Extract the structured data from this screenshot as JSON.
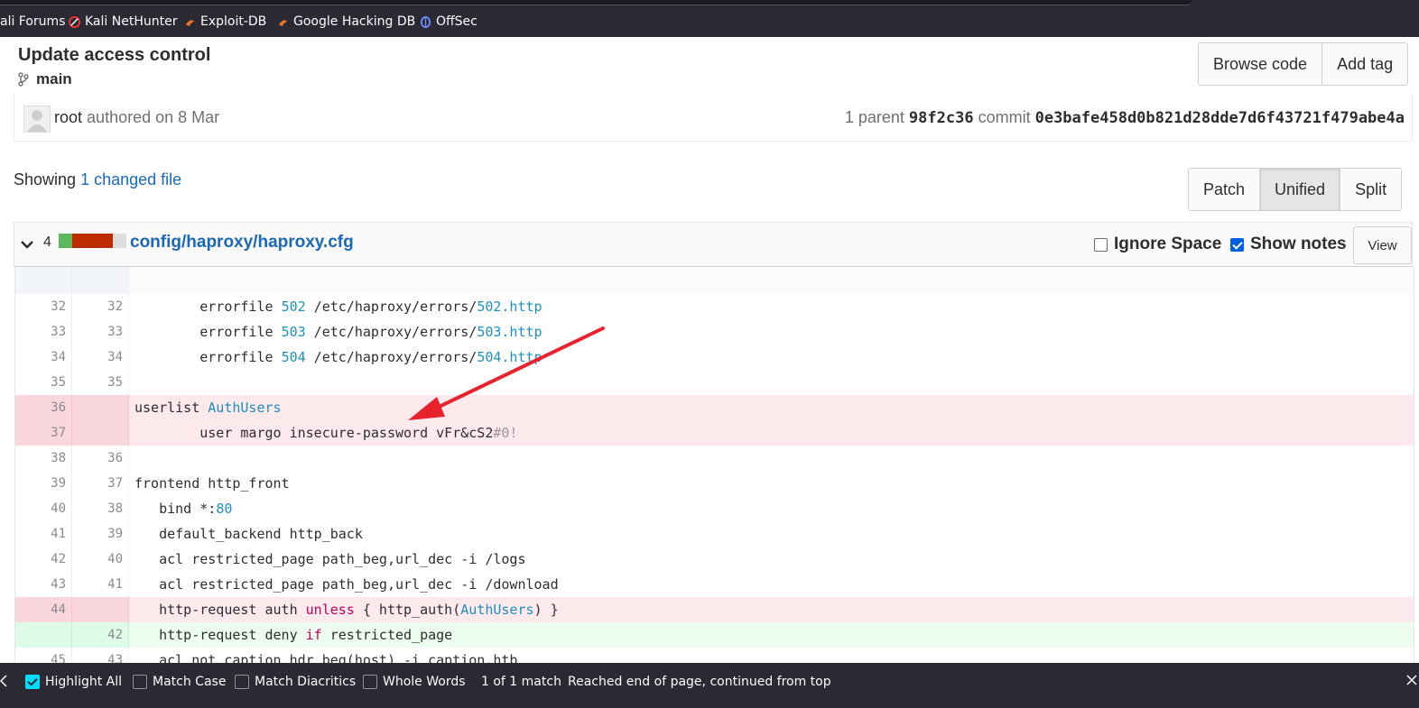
{
  "bookmarks": [
    {
      "label": "ali Forums",
      "icon": "forum-icon"
    },
    {
      "label": "Kali NetHunter",
      "icon": "nethunter-icon"
    },
    {
      "label": "Exploit-DB",
      "icon": "exploitdb-icon"
    },
    {
      "label": "Google Hacking DB",
      "icon": "ghdb-icon"
    },
    {
      "label": "OffSec",
      "icon": "offsec-icon"
    }
  ],
  "commit": {
    "title": "Update access control",
    "branch": "main",
    "browse_code": "Browse code",
    "add_tag": "Add tag",
    "author": "root",
    "authored_text": "authored on 8 Mar",
    "parent_label": "1 parent",
    "parent_sha": "98f2c36",
    "commit_label": "commit",
    "commit_sha": "0e3bafe458d0b821d28dde7d6f43721f479abe4a"
  },
  "changes": {
    "showing": "Showing",
    "changed_link": "1 changed file",
    "view_modes": [
      "Patch",
      "Unified",
      "Split"
    ],
    "active_mode": "Unified"
  },
  "file": {
    "change_count": "4",
    "path": "config/haproxy/haproxy.cfg",
    "ignore_space": "Ignore Space",
    "show_notes": "Show notes",
    "view": "View"
  },
  "diff_lines": [
    {
      "old": "32",
      "new": "32",
      "type": "ctx"
    },
    {
      "old": "33",
      "new": "33",
      "type": "ctx"
    },
    {
      "old": "34",
      "new": "34",
      "type": "ctx"
    },
    {
      "old": "35",
      "new": "35",
      "type": "ctx"
    },
    {
      "old": "36",
      "new": "",
      "type": "del"
    },
    {
      "old": "37",
      "new": "",
      "type": "del"
    },
    {
      "old": "38",
      "new": "36",
      "type": "ctx"
    },
    {
      "old": "39",
      "new": "37",
      "type": "ctx"
    },
    {
      "old": "40",
      "new": "38",
      "type": "ctx"
    },
    {
      "old": "41",
      "new": "39",
      "type": "ctx"
    },
    {
      "old": "42",
      "new": "40",
      "type": "ctx"
    },
    {
      "old": "43",
      "new": "41",
      "type": "ctx"
    },
    {
      "old": "44",
      "new": "",
      "type": "del"
    },
    {
      "old": "",
      "new": "42",
      "type": "add"
    },
    {
      "old": "45",
      "new": "43",
      "type": "ctx"
    }
  ],
  "code": {
    "l32_a": "        errorfile ",
    "l32_n": "502",
    "l32_b": " /etc/haproxy/errors/",
    "l32_c": "502.http",
    "l33_a": "        errorfile ",
    "l33_n": "503",
    "l33_b": " /etc/haproxy/errors/",
    "l33_c": "503.http",
    "l34_a": "        errorfile ",
    "l34_n": "504",
    "l34_b": " /etc/haproxy/errors/",
    "l34_c": "504.http",
    "l36_a": "userlist ",
    "l36_b": "AuthUsers",
    "l37_a": "        user margo insecure-password vFr&cS2",
    "l37_b": "#0!",
    "l39": "frontend http_front",
    "l40_a": "   bind *:",
    "l40_b": "80",
    "l41": "   default_backend http_back",
    "l42": "   acl restricted_page path_beg,url_dec -i /logs",
    "l43": "   acl restricted_page path_beg,url_dec -i /download",
    "l44_a": "   http-request auth ",
    "l44_b": "unless",
    "l44_c": " { http_auth(",
    "l44_d": "AuthUsers",
    "l44_e": ") }",
    "l42n_a": "   http-request deny ",
    "l42n_b": "if",
    "l42n_c": " restricted_page",
    "l45": "   acl not_caption hdr_beg(host) -i caption.htb"
  },
  "findbar": {
    "highlight_all": "Highlight All",
    "match_case": "Match Case",
    "match_diacritics": "Match Diacritics",
    "whole_words": "Whole Words",
    "count": "1 of 1 match",
    "status": "Reached end of page, continued from top"
  },
  "colors": {
    "link": "#1b69b6",
    "deleted_bg": "#fbe9eb",
    "added_bg": "#ecfdf0",
    "annotation_arrow": "#e8222c"
  }
}
